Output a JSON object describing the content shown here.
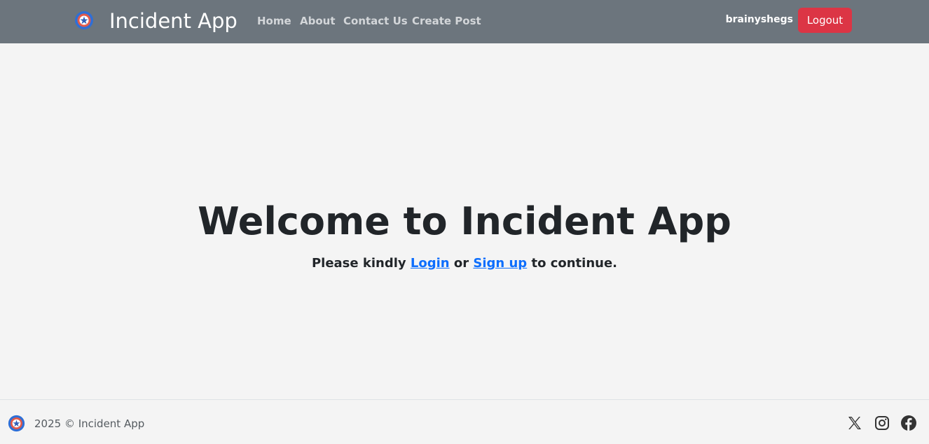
{
  "navbar": {
    "brand_title": "Incident App",
    "links": [
      {
        "label": "Home"
      },
      {
        "label": "About"
      },
      {
        "label": "Contact Us"
      },
      {
        "label": "Create Post"
      }
    ],
    "username": "brainyshegs",
    "logout_label": "Logout"
  },
  "hero": {
    "title": "Welcome to Incident App",
    "sub_prefix": "Please kindly ",
    "login_link": "Login",
    "sub_middle": " or ",
    "signup_link": "Sign up",
    "sub_suffix": " to continue."
  },
  "footer": {
    "copyright": "2025 © Incident App",
    "social_icons": [
      "x-icon",
      "instagram-icon",
      "facebook-icon"
    ]
  },
  "colors": {
    "navbar_bg": "#6c757d",
    "logout_bg": "#dc3545",
    "link_blue": "#0d6efd",
    "page_bg": "#f4f4f4"
  }
}
